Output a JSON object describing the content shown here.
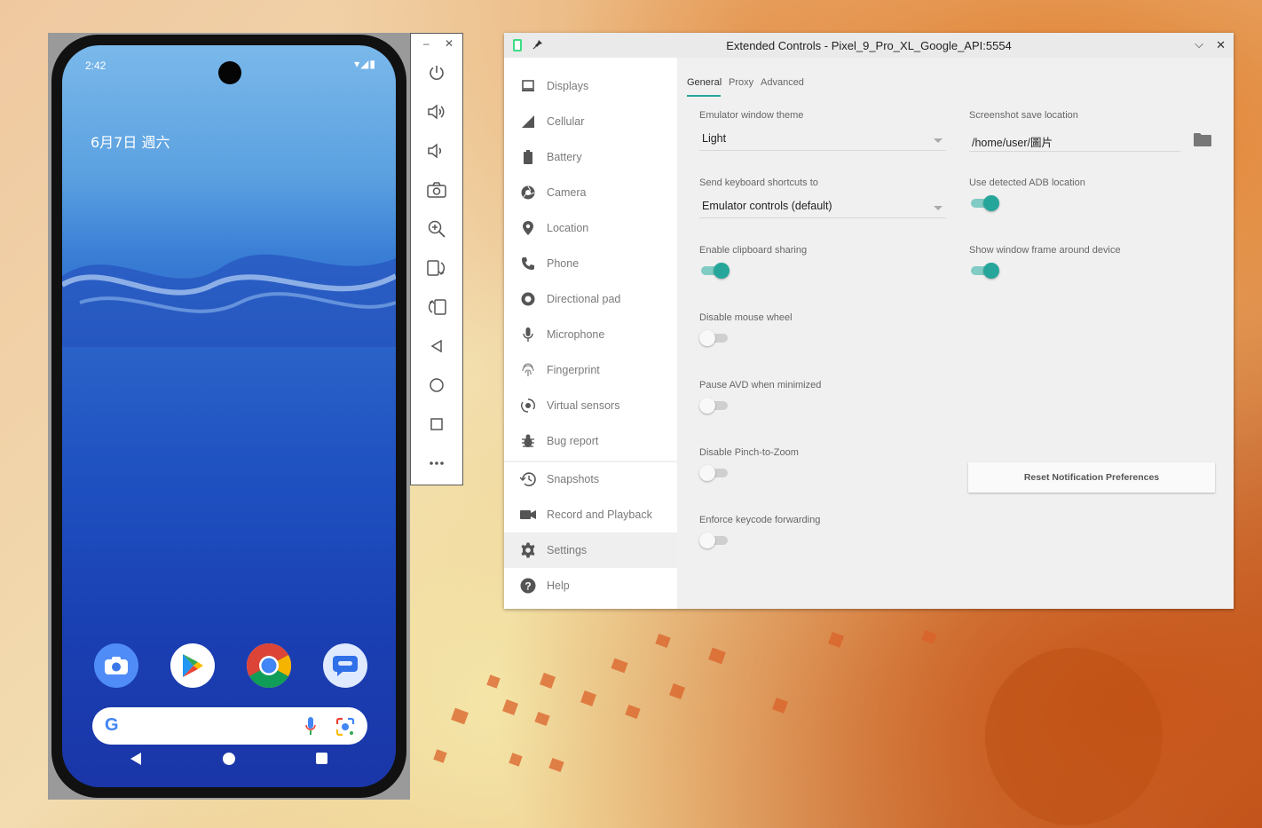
{
  "phone": {
    "status_time": "2:42",
    "status_icons": "▾◢▮",
    "date": "6月7日 週六",
    "apps": [
      "Camera",
      "Play Store",
      "Chrome",
      "Messages"
    ],
    "search_logo": "G"
  },
  "toolbar": {
    "minimize": "–",
    "close": "✕",
    "buttons": [
      "power",
      "volume-up",
      "volume-down",
      "screenshot",
      "zoom",
      "rotate-left",
      "rotate-right",
      "back",
      "home",
      "overview",
      "more"
    ]
  },
  "window": {
    "title": "Extended Controls - Pixel_9_Pro_XL_Google_API:5554",
    "collapse_glyph": "⌵",
    "close_glyph": "✕"
  },
  "sidebar": {
    "items": [
      {
        "label": "Displays"
      },
      {
        "label": "Cellular"
      },
      {
        "label": "Battery"
      },
      {
        "label": "Camera"
      },
      {
        "label": "Location"
      },
      {
        "label": "Phone"
      },
      {
        "label": "Directional pad"
      },
      {
        "label": "Microphone"
      },
      {
        "label": "Fingerprint"
      },
      {
        "label": "Virtual sensors"
      },
      {
        "label": "Bug report"
      },
      {
        "label": "Snapshots"
      },
      {
        "label": "Record and Playback"
      },
      {
        "label": "Settings"
      },
      {
        "label": "Help"
      }
    ],
    "active": "Settings"
  },
  "tabs": [
    "General",
    "Proxy",
    "Advanced"
  ],
  "settings": {
    "theme_label": "Emulator window theme",
    "theme_value": "Light",
    "screenshot_label": "Screenshot save location",
    "screenshot_value": "/home/user/圖片",
    "shortcuts_label": "Send keyboard shortcuts to",
    "shortcuts_value": "Emulator controls (default)",
    "adb_label": "Use detected ADB location",
    "adb_on": true,
    "clipboard_label": "Enable clipboard sharing",
    "clipboard_on": true,
    "frame_label": "Show window frame around device",
    "frame_on": true,
    "mouse_label": "Disable mouse wheel",
    "mouse_on": false,
    "pause_label": "Pause AVD when minimized",
    "pause_on": false,
    "pinch_label": "Disable Pinch-to-Zoom",
    "pinch_on": false,
    "keycode_label": "Enforce keycode forwarding",
    "keycode_on": false,
    "reset_button": "Reset Notification Preferences"
  },
  "colors": {
    "accent": "#26a69a",
    "accent_track": "#80cbc4"
  }
}
